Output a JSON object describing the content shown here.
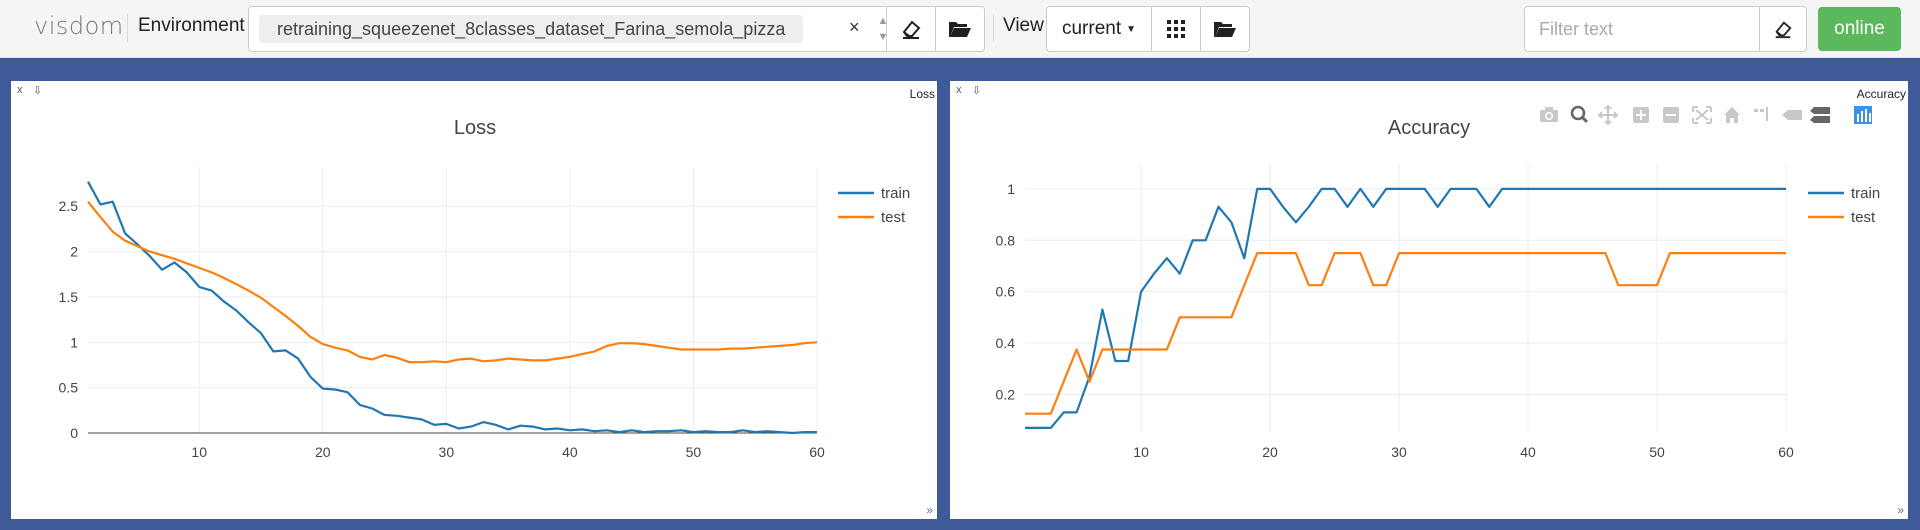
{
  "topbar": {
    "brand": "visdom",
    "env_label": "Environment",
    "env_value": "retraining_squeezenet_8classes_dataset_Farina_semola_pizza",
    "env_clear": "×",
    "view_label": "View",
    "view_value": "current",
    "filter_placeholder": "Filter text",
    "online_label": "online"
  },
  "panes": [
    {
      "tab": "Loss"
    },
    {
      "tab": "Accuracy"
    }
  ],
  "chart_data": [
    {
      "type": "line",
      "title": "Loss",
      "xlabel": "",
      "ylabel": "",
      "xlim": [
        1,
        60
      ],
      "ylim": [
        0,
        2.8
      ],
      "xticks": [
        10,
        20,
        30,
        40,
        50,
        60
      ],
      "yticks": [
        0,
        0.5,
        1,
        1.5,
        2,
        2.5
      ],
      "ytick_labels": [
        "0",
        "0.5",
        "1",
        "1.5",
        "2",
        "2.5"
      ],
      "grid": true,
      "legend": "top-right",
      "x": [
        1,
        2,
        3,
        4,
        5,
        6,
        7,
        8,
        9,
        10,
        11,
        12,
        13,
        14,
        15,
        16,
        17,
        18,
        19,
        20,
        21,
        22,
        23,
        24,
        25,
        26,
        27,
        28,
        29,
        30,
        31,
        32,
        33,
        34,
        35,
        36,
        37,
        38,
        39,
        40,
        41,
        42,
        43,
        44,
        45,
        46,
        47,
        48,
        49,
        50,
        51,
        52,
        53,
        54,
        55,
        56,
        57,
        58,
        59,
        60
      ],
      "series": [
        {
          "name": "train",
          "color": "#1f77b4",
          "values": [
            2.77,
            2.52,
            2.55,
            2.2,
            2.08,
            1.95,
            1.8,
            1.88,
            1.77,
            1.61,
            1.57,
            1.45,
            1.35,
            1.22,
            1.1,
            0.9,
            0.91,
            0.82,
            0.62,
            0.49,
            0.48,
            0.45,
            0.31,
            0.27,
            0.2,
            0.19,
            0.17,
            0.15,
            0.09,
            0.1,
            0.05,
            0.07,
            0.12,
            0.09,
            0.04,
            0.08,
            0.07,
            0.04,
            0.05,
            0.03,
            0.04,
            0.02,
            0.03,
            0.01,
            0.03,
            0.01,
            0.02,
            0.02,
            0.03,
            0.01,
            0.02,
            0.01,
            0.01,
            0.03,
            0.01,
            0.02,
            0.01,
            0.0,
            0.01,
            0.01
          ]
        },
        {
          "name": "test",
          "color": "#ff7f0e",
          "values": [
            2.55,
            2.38,
            2.22,
            2.12,
            2.06,
            2.0,
            1.96,
            1.92,
            1.87,
            1.82,
            1.77,
            1.71,
            1.64,
            1.57,
            1.49,
            1.39,
            1.29,
            1.18,
            1.06,
            0.98,
            0.94,
            0.91,
            0.84,
            0.81,
            0.86,
            0.83,
            0.78,
            0.78,
            0.79,
            0.78,
            0.81,
            0.82,
            0.79,
            0.8,
            0.82,
            0.81,
            0.8,
            0.8,
            0.82,
            0.84,
            0.87,
            0.9,
            0.96,
            0.99,
            0.99,
            0.98,
            0.96,
            0.94,
            0.92,
            0.92,
            0.92,
            0.92,
            0.93,
            0.93,
            0.94,
            0.95,
            0.96,
            0.97,
            0.99,
            1.0
          ]
        }
      ]
    },
    {
      "type": "line",
      "title": "Accuracy",
      "xlabel": "",
      "ylabel": "",
      "xlim": [
        1,
        60
      ],
      "ylim": [
        0.05,
        1.05
      ],
      "xticks": [
        10,
        20,
        30,
        40,
        50,
        60
      ],
      "yticks": [
        0.2,
        0.4,
        0.6,
        0.8,
        1
      ],
      "ytick_labels": [
        "0.2",
        "0.4",
        "0.6",
        "0.8",
        "1"
      ],
      "grid": true,
      "legend": "top-right",
      "x": [
        1,
        2,
        3,
        4,
        5,
        6,
        7,
        8,
        9,
        10,
        11,
        12,
        13,
        14,
        15,
        16,
        17,
        18,
        19,
        20,
        21,
        22,
        23,
        24,
        25,
        26,
        27,
        28,
        29,
        30,
        31,
        32,
        33,
        34,
        35,
        36,
        37,
        38,
        39,
        40,
        41,
        42,
        43,
        44,
        45,
        46,
        47,
        48,
        49,
        50,
        51,
        52,
        53,
        54,
        55,
        56,
        57,
        58,
        59,
        60
      ],
      "series": [
        {
          "name": "train",
          "color": "#1f77b4",
          "values": [
            0.07,
            0.07,
            0.07,
            0.13,
            0.13,
            0.27,
            0.53,
            0.33,
            0.33,
            0.6,
            0.67,
            0.73,
            0.67,
            0.8,
            0.8,
            0.93,
            0.87,
            0.73,
            1,
            1,
            0.93,
            0.87,
            0.93,
            1,
            1,
            0.93,
            1,
            0.93,
            1,
            1,
            1,
            1,
            0.93,
            1,
            1,
            1,
            0.93,
            1,
            1,
            1,
            1,
            1,
            1,
            1,
            1,
            1,
            1,
            1,
            1,
            1,
            1,
            1,
            1,
            1,
            1,
            1,
            1,
            1,
            1,
            1
          ]
        },
        {
          "name": "test",
          "color": "#ff7f0e",
          "values": [
            0.125,
            0.125,
            0.125,
            0.25,
            0.375,
            0.25,
            0.375,
            0.375,
            0.375,
            0.375,
            0.375,
            0.375,
            0.5,
            0.5,
            0.5,
            0.5,
            0.5,
            0.625,
            0.75,
            0.75,
            0.75,
            0.75,
            0.625,
            0.625,
            0.75,
            0.75,
            0.75,
            0.625,
            0.625,
            0.75,
            0.75,
            0.75,
            0.75,
            0.75,
            0.75,
            0.75,
            0.75,
            0.75,
            0.75,
            0.75,
            0.75,
            0.75,
            0.75,
            0.75,
            0.75,
            0.75,
            0.625,
            0.625,
            0.625,
            0.625,
            0.75,
            0.75,
            0.75,
            0.75,
            0.75,
            0.75,
            0.75,
            0.75,
            0.75,
            0.75
          ]
        }
      ]
    }
  ]
}
